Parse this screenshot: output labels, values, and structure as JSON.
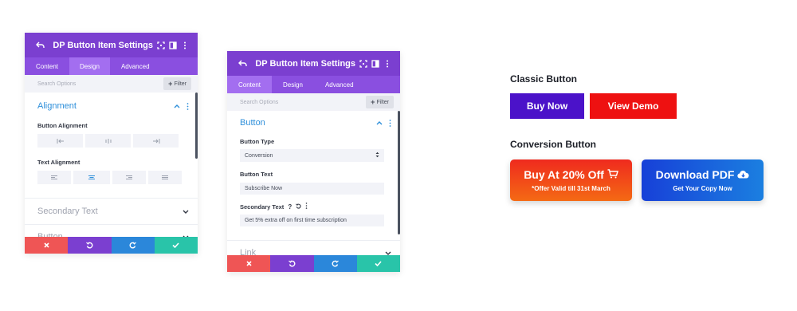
{
  "panel1": {
    "title": "DP Button Item Settings",
    "tabs": [
      "Content",
      "Design",
      "Advanced"
    ],
    "search_placeholder": "Search Options",
    "filter_label": "Filter",
    "section_title": "Alignment",
    "button_alignment_label": "Button Alignment",
    "text_alignment_label": "Text Alignment",
    "secondary_section": "Secondary Text",
    "button_section": "Button"
  },
  "panel2": {
    "title": "DP Button Item Settings",
    "tabs": [
      "Content",
      "Design",
      "Advanced"
    ],
    "search_placeholder": "Search Options",
    "filter_label": "Filter",
    "section_title": "Button",
    "button_type_label": "Button Type",
    "button_type_value": "Conversion",
    "button_text_label": "Button Text",
    "button_text_value": "Subscribe Now",
    "secondary_text_label": "Secondary Text",
    "secondary_text_value": "Get 5% extra off on first time subscription",
    "link_section": "Link"
  },
  "preview": {
    "classic_title": "Classic Button",
    "buy_now": "Buy Now",
    "view_demo": "View Demo",
    "conversion_title": "Conversion Button",
    "buy_main": "Buy At 20% Off",
    "buy_sub": "*Offer Valid till 31st March",
    "download_main": "Download PDF",
    "download_sub": "Get Your Copy Now"
  },
  "colors": {
    "header_purple": "#7b3fd0",
    "accent_blue": "#2e8fda",
    "buy_now_bg": "#4b12c9",
    "view_demo_bg": "#ee1111",
    "cancel_red": "#ef5555",
    "save_green": "#29c4a9"
  }
}
